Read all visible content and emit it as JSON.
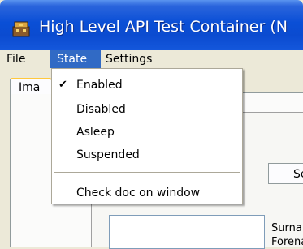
{
  "window": {
    "title": "High Level API Test Container (N",
    "icon": "app-icon"
  },
  "menubar": {
    "items": [
      {
        "label": "File"
      },
      {
        "label": "State"
      },
      {
        "label": "Settings"
      }
    ]
  },
  "state_menu": {
    "items": [
      {
        "label": "Enabled",
        "checked": true
      },
      {
        "label": "Disabled",
        "checked": false
      },
      {
        "label": "Asleep",
        "checked": false
      },
      {
        "label": "Suspended",
        "checked": false
      },
      {
        "label": "Check doc on window",
        "checked": false
      }
    ],
    "check_glyph": "✔"
  },
  "content": {
    "tab_label": "Ima",
    "sub_tab_label": "Se",
    "surname_label": "Surna",
    "forename_label": "Forena"
  },
  "colors": {
    "titlebar": "#0b4bd0",
    "menu_highlight": "#316ac5",
    "window_bg": "#ece9d8"
  }
}
